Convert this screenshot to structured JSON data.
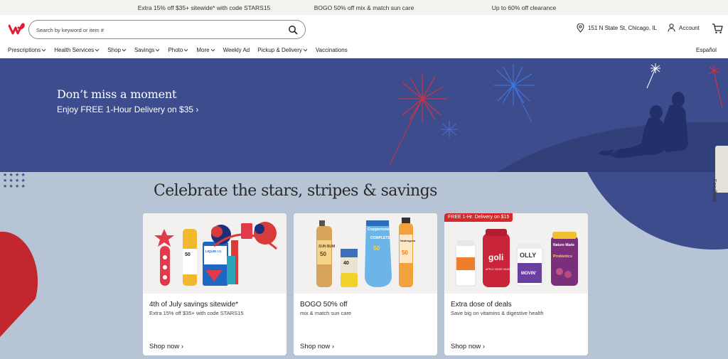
{
  "promos": [
    "Extra 15% off $35+ sitewide* with code STARS15",
    "BOGO 50% off mix & match sun care",
    "Up to 60% off clearance"
  ],
  "header": {
    "search_placeholder": "Search by keyword or item #",
    "location": "151 N State St, Chicago, IL",
    "account": "Account"
  },
  "nav": {
    "items": [
      {
        "label": "Prescriptions",
        "has_menu": true
      },
      {
        "label": "Health Services",
        "has_menu": true
      },
      {
        "label": "Shop",
        "has_menu": true
      },
      {
        "label": "Savings",
        "has_menu": true
      },
      {
        "label": "Photo",
        "has_menu": true
      },
      {
        "label": "More",
        "has_menu": true
      },
      {
        "label": "Weekly Ad",
        "has_menu": false
      },
      {
        "label": "Pickup & Delivery",
        "has_menu": true
      },
      {
        "label": "Vaccinations",
        "has_menu": false
      }
    ],
    "language": "Español"
  },
  "hero": {
    "title": "Don’t miss a moment",
    "subtitle": "Enjoy FREE 1-Hour Delivery on $35 ›"
  },
  "feedback": "Feedback",
  "section": {
    "title": "Celebrate the stars, stripes & savings"
  },
  "cards": [
    {
      "title": "4th of July savings sitewide*",
      "subtitle": "Extra 15% off $35+ with code STARS15",
      "link": "Shop now ›"
    },
    {
      "title": "BOGO 50% off",
      "subtitle": "mix & match sun care",
      "link": "Shop now ›"
    },
    {
      "title": "Extra dose of deals",
      "subtitle": "Save big on vitamins & digestive health",
      "link": "Shop now ›",
      "badge": "FREE 1-Hr. Delivery on $15"
    }
  ],
  "product_labels": {
    "sunscreen_spf": "50",
    "liquid_iv": "LIQUID I.V.",
    "liquid_iv_sub": "HYDRATION MULTIPLIER",
    "sun_bum": "SUN BUM",
    "sun_bum_spf": "50",
    "small_spf": "40",
    "coppertone": "Coppertone",
    "coppertone_sub": "COMPLETE",
    "coppertone_spf": "50",
    "neutrogena": "Neutrogena",
    "neutrogena_spf": "50",
    "goli": "goli",
    "goli_sub": "APPLE CIDER VINEGAR",
    "olly": "OLLY",
    "olly_sub": "MOVIN'",
    "natures_made": "Nature Made",
    "probiotics": "Probiotics"
  },
  "colors": {
    "brand_red": "#e31837",
    "hero_blue": "#3c4c8c",
    "page_bg": "#b7c4d6",
    "badge_red": "#d5282a"
  }
}
